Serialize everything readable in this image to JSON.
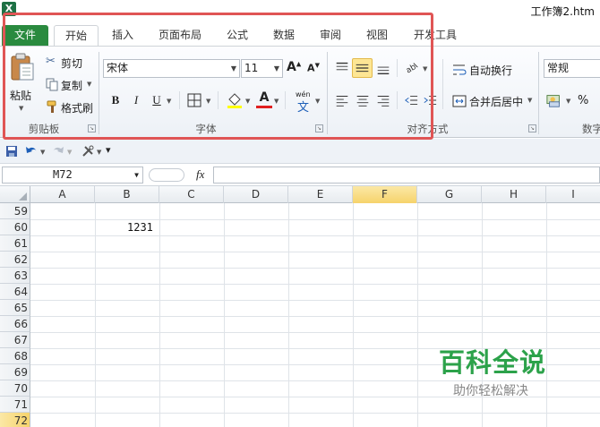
{
  "window": {
    "title": "工作簿2.htm",
    "app_icon_letter": "X"
  },
  "tabs": [
    "文件",
    "开始",
    "插入",
    "页面布局",
    "公式",
    "数据",
    "审阅",
    "视图",
    "开发工具"
  ],
  "active_tab": "开始",
  "ribbon": {
    "clipboard": {
      "group_label": "剪贴板",
      "paste": "粘贴",
      "cut": "剪切",
      "copy": "复制",
      "format_painter": "格式刷"
    },
    "font": {
      "group_label": "字体",
      "font_name": "宋体",
      "font_size": "11",
      "bold": "B",
      "italic": "I",
      "underline": "U",
      "phonetic": "wén"
    },
    "alignment": {
      "group_label": "对齐方式",
      "wrap_text": "自动换行",
      "merge_center": "合并后居中"
    },
    "number": {
      "group_label": "数字",
      "format": "常规",
      "percent": "%"
    }
  },
  "formula_bar": {
    "name_box": "M72",
    "fx": "fx",
    "value": ""
  },
  "grid": {
    "columns": [
      "A",
      "B",
      "C",
      "D",
      "E",
      "F",
      "G",
      "H",
      "I"
    ],
    "selected_column": "F",
    "rows": [
      "59",
      "60",
      "61",
      "62",
      "63",
      "64",
      "65",
      "66",
      "67",
      "68",
      "69",
      "70",
      "71",
      "72"
    ],
    "selected_row": "72",
    "cells": {
      "B60": "1231"
    }
  },
  "watermark": {
    "main": "百科全说",
    "sub": "助你轻松解决"
  },
  "colors": {
    "file_tab": "#2a8a3f",
    "highlight": "#e05555",
    "selection": "#f6d36b",
    "watermark": "#2ca24a"
  }
}
